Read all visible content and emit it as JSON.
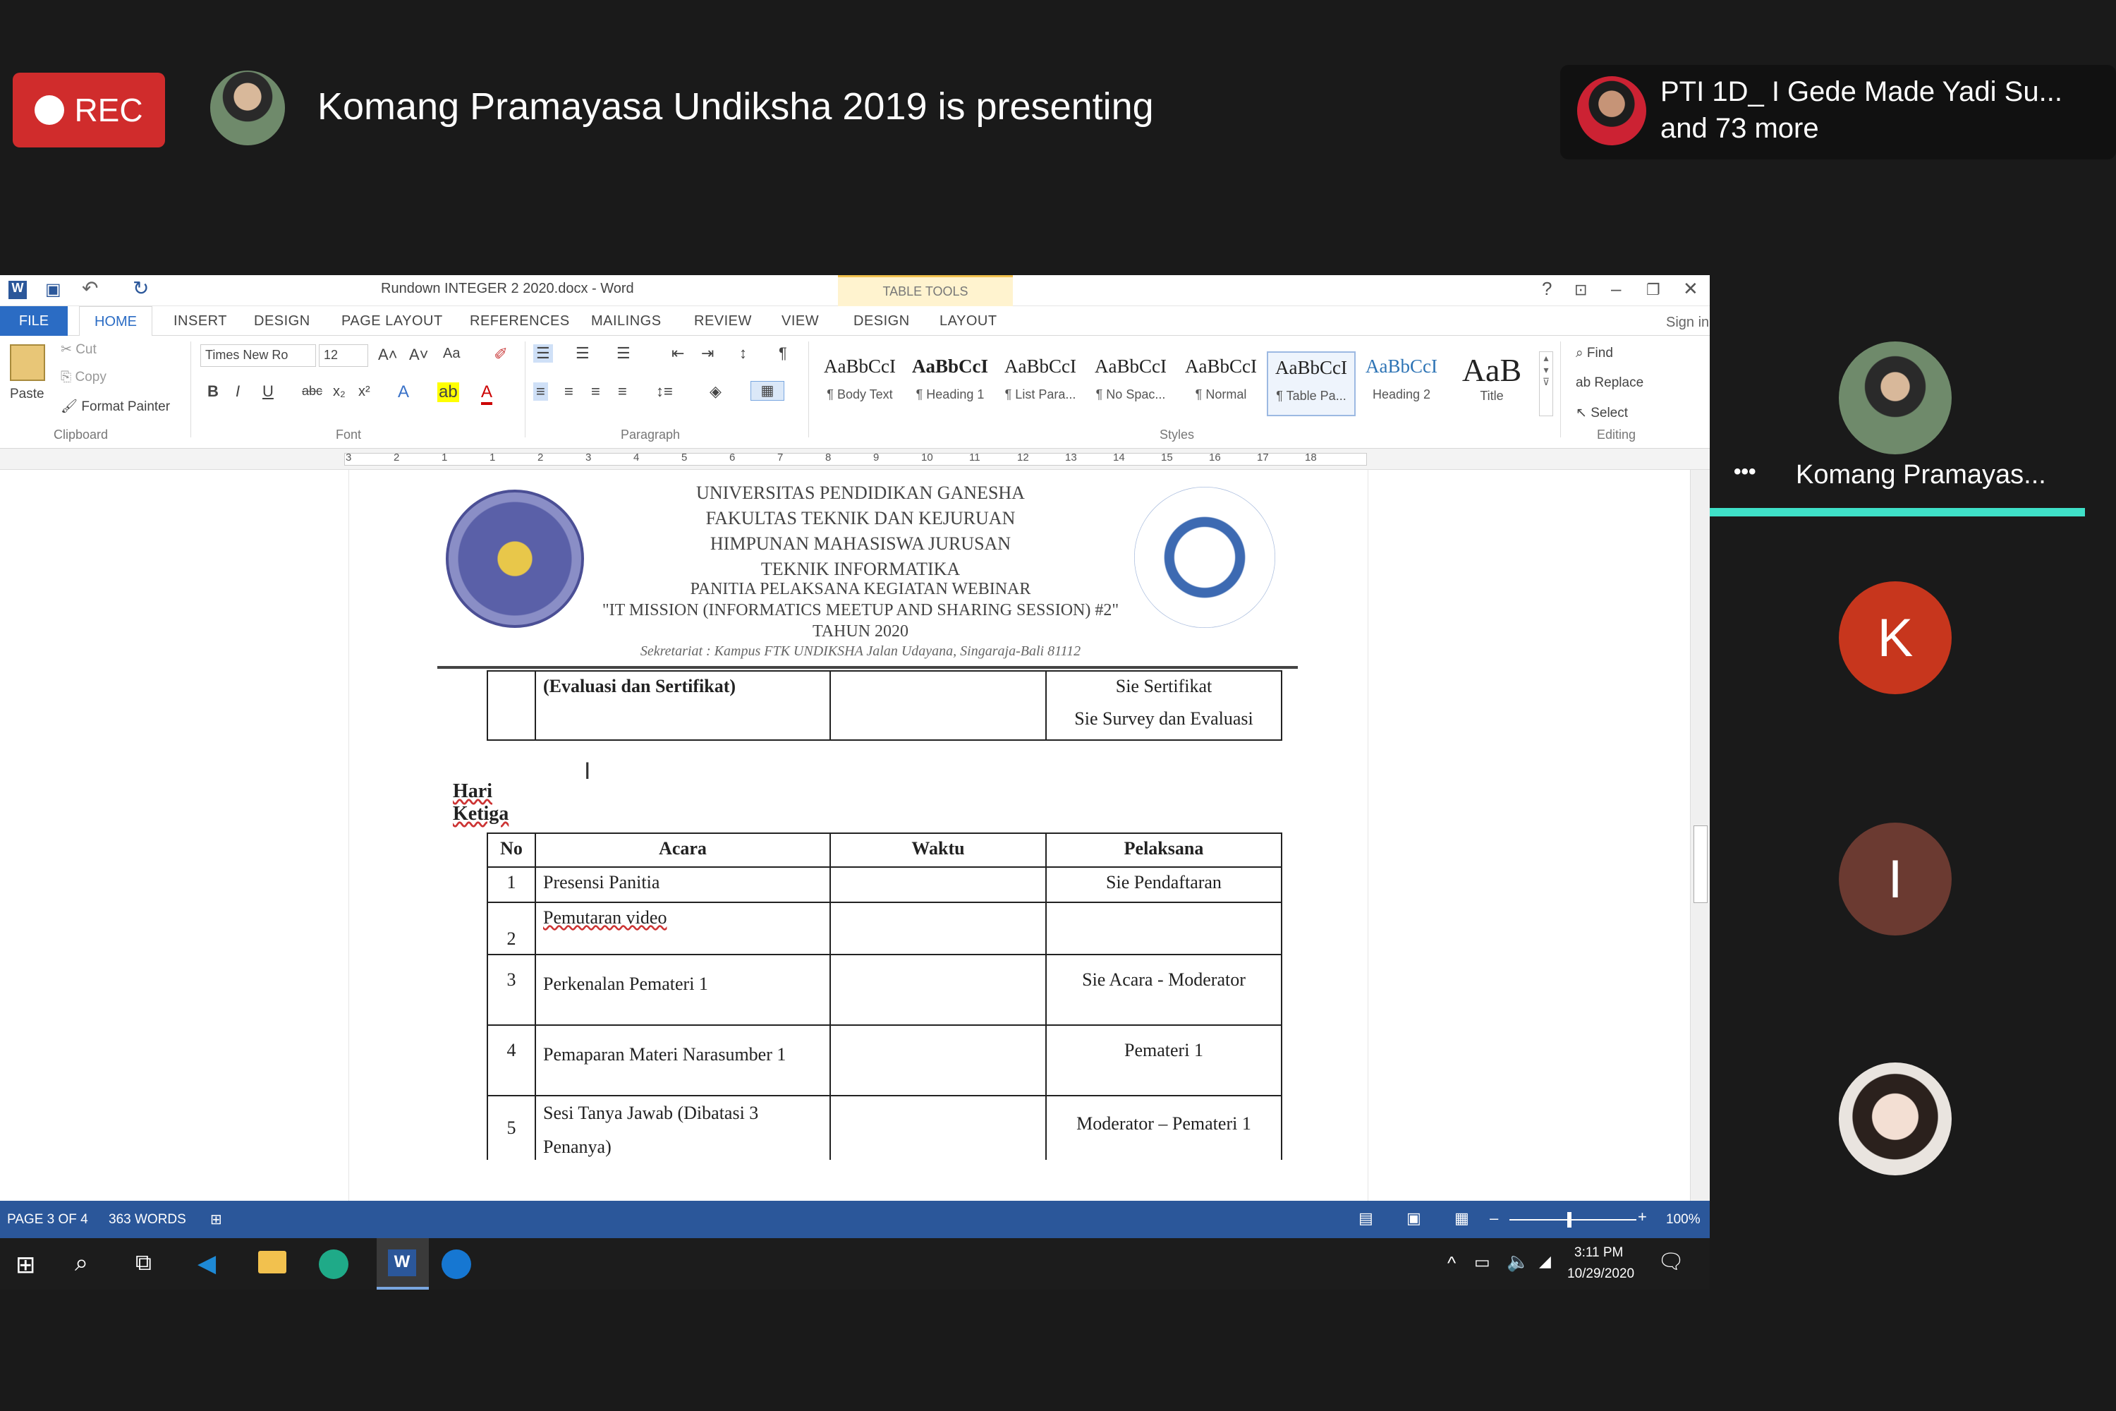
{
  "meeting": {
    "rec_label": "REC",
    "presenting": "Komang Pramayasa Undiksha 2019 is presenting",
    "attendee_name": "PTI 1D_ I Gede Made Yadi Su...",
    "attendee_more": "and 73 more"
  },
  "word": {
    "title": "Rundown INTEGER 2 2020.docx - Word",
    "table_tools": "TABLE TOOLS",
    "signin": "Sign in",
    "tabs": [
      "FILE",
      "HOME",
      "INSERT",
      "DESIGN",
      "PAGE LAYOUT",
      "REFERENCES",
      "MAILINGS",
      "REVIEW",
      "VIEW",
      "DESIGN",
      "LAYOUT"
    ],
    "clipboard": {
      "paste": "Paste",
      "cut": "Cut",
      "copy": "Copy",
      "format_painter": "Format Painter",
      "group": "Clipboard"
    },
    "font": {
      "name": "Times New Ro",
      "size": "12",
      "group": "Font"
    },
    "paragraph_group": "Paragraph",
    "styles": [
      {
        "sample": "AaBbCcI",
        "name": "¶ Body Text"
      },
      {
        "sample": "AaBbCcI",
        "name": "¶ Heading 1"
      },
      {
        "sample": "AaBbCcI",
        "name": "¶ List Para..."
      },
      {
        "sample": "AaBbCcI",
        "name": "¶ No Spac..."
      },
      {
        "sample": "AaBbCcI",
        "name": "¶ Normal"
      },
      {
        "sample": "AaBbCcI",
        "name": "¶ Table Pa..."
      },
      {
        "sample": "AaBbCcI",
        "name": "Heading 2"
      },
      {
        "sample": "AaB",
        "name": "Title"
      }
    ],
    "styles_group": "Styles",
    "editing": {
      "find": "Find",
      "replace": "Replace",
      "select": "Select",
      "group": "Editing"
    },
    "ruler_numbers": [
      "3",
      "2",
      "1",
      "1",
      "2",
      "3",
      "4",
      "5",
      "6",
      "7",
      "8",
      "9",
      "10",
      "11",
      "12",
      "13",
      "14",
      "15",
      "16",
      "17",
      "18"
    ],
    "status": {
      "page": "PAGE 3 OF 4",
      "words": "363 WORDS",
      "zoom": "100%"
    }
  },
  "doc": {
    "letterhead": [
      "UNIVERSITAS PENDIDIKAN GANESHA",
      "FAKULTAS TEKNIK DAN KEJURUAN",
      "HIMPUNAN MAHASISWA JURUSAN",
      "TEKNIK INFORMATIKA",
      "PANITIA PELAKSANA KEGIATAN WEBINAR",
      "\"IT MISSION (INFORMATICS MEETUP AND SHARING SESSION) #2\"",
      "TAHUN 2020"
    ],
    "address": "Sekretariat : Kampus FTK UNDIKSHA Jalan Udayana, Singaraja-Bali 81112",
    "prev_row": {
      "acara": "(Evaluasi dan Sertifikat)",
      "pelaksana1": "Sie Sertifikat",
      "pelaksana2": "Sie Survey dan Evaluasi"
    },
    "section_title": "Hari Ketiga",
    "headers": {
      "no": "No",
      "acara": "Acara",
      "waktu": "Waktu",
      "pelaksana": "Pelaksana"
    },
    "rows": [
      {
        "no": "1",
        "acara": "Presensi Panitia",
        "waktu": "",
        "pelaksana": "Sie Pendaftaran"
      },
      {
        "no": "2",
        "acara": "Pemutaran video",
        "waktu": "",
        "pelaksana": ""
      },
      {
        "no": "3",
        "acara": "Perkenalan Pemateri 1",
        "waktu": "",
        "pelaksana": "Sie Acara - Moderator"
      },
      {
        "no": "4",
        "acara": "Pemaparan Materi Narasumber 1",
        "waktu": "",
        "pelaksana": "Pemateri 1"
      },
      {
        "no": "5",
        "acara": "Sesi Tanya Jawab (Dibatasi 3 Penanya)",
        "waktu": "",
        "pelaksana": "Moderator – Pemateri 1"
      }
    ]
  },
  "taskbar": {
    "time": "3:11 PM",
    "date": "10/29/2020"
  },
  "sidebar": {
    "presenter_name": "Komang Pramayas...",
    "p2_initial": "K",
    "p3_initial": "I",
    "colors": {
      "k": "#c7361d",
      "i": "#6b3a31",
      "accent": "#3fe0c8"
    }
  }
}
